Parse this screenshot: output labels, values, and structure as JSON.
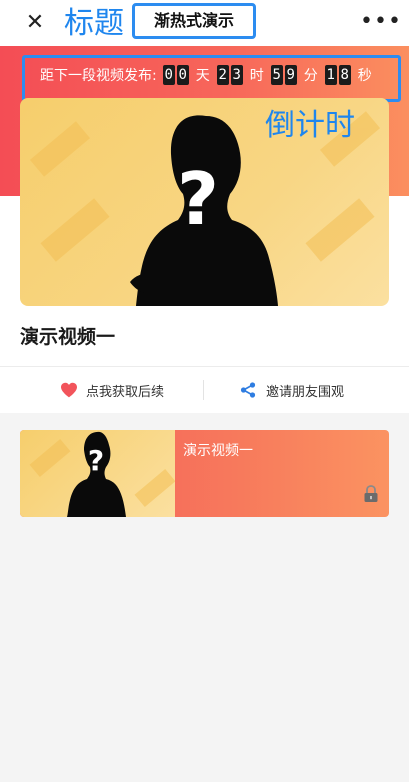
{
  "header": {
    "close_icon": "close-icon",
    "title": "渐热式演示",
    "more_icon": "more-dots-icon",
    "annotation_title": "标题"
  },
  "countdown": {
    "label": "距下一段视频发布:",
    "days": [
      "0",
      "0"
    ],
    "days_unit": "天",
    "hours": [
      "2",
      "3"
    ],
    "hours_unit": "时",
    "minutes": [
      "5",
      "9"
    ],
    "minutes_unit": "分",
    "seconds": [
      "1",
      "8"
    ],
    "seconds_unit": "秒",
    "annotation": "倒计时"
  },
  "video": {
    "title": "演示视频一",
    "thumbnail_icon": "mystery-person-silhouette"
  },
  "actions": {
    "left_label": "点我获取后续",
    "left_icon": "heart-icon",
    "right_label": "邀请朋友围观",
    "right_icon": "share-icon"
  },
  "list": [
    {
      "title": "演示视频一",
      "locked": true,
      "lock_icon": "lock-icon"
    }
  ],
  "colors": {
    "accent_red": "#f44d55",
    "accent_orange": "#fb8f5f",
    "thumb_yellow": "#f6ce6c",
    "annotation_blue": "#2c8cf0",
    "heart_red": "#f2545b",
    "share_blue": "#2f7de1"
  }
}
